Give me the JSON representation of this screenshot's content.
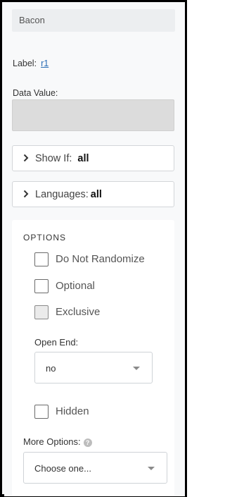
{
  "header": {
    "name": "Bacon"
  },
  "label": {
    "caption": "Label:",
    "value": "r1"
  },
  "data_value": {
    "caption": "Data Value:",
    "value": ""
  },
  "show_if": {
    "caption": "Show If:",
    "value": "all",
    "icon": "chevron-right-icon"
  },
  "languages": {
    "caption": "Languages:",
    "value": "all",
    "icon": "chevron-right-icon"
  },
  "options": {
    "title": "OPTIONS",
    "do_not_randomize": {
      "label": "Do Not Randomize",
      "checked": false
    },
    "optional": {
      "label": "Optional",
      "checked": false
    },
    "exclusive": {
      "label": "Exclusive",
      "checked": false,
      "disabled": true
    },
    "open_end": {
      "caption": "Open End:",
      "selected": "no"
    },
    "hidden": {
      "label": "Hidden",
      "checked": false
    },
    "more_options": {
      "caption": "More Options:",
      "help_icon": "question-circle-icon",
      "selected": "Choose one..."
    }
  },
  "colors": {
    "link": "#2a6db5",
    "panel_bg": "#f8f9fa",
    "field_disabled": "#dcdcdc"
  }
}
